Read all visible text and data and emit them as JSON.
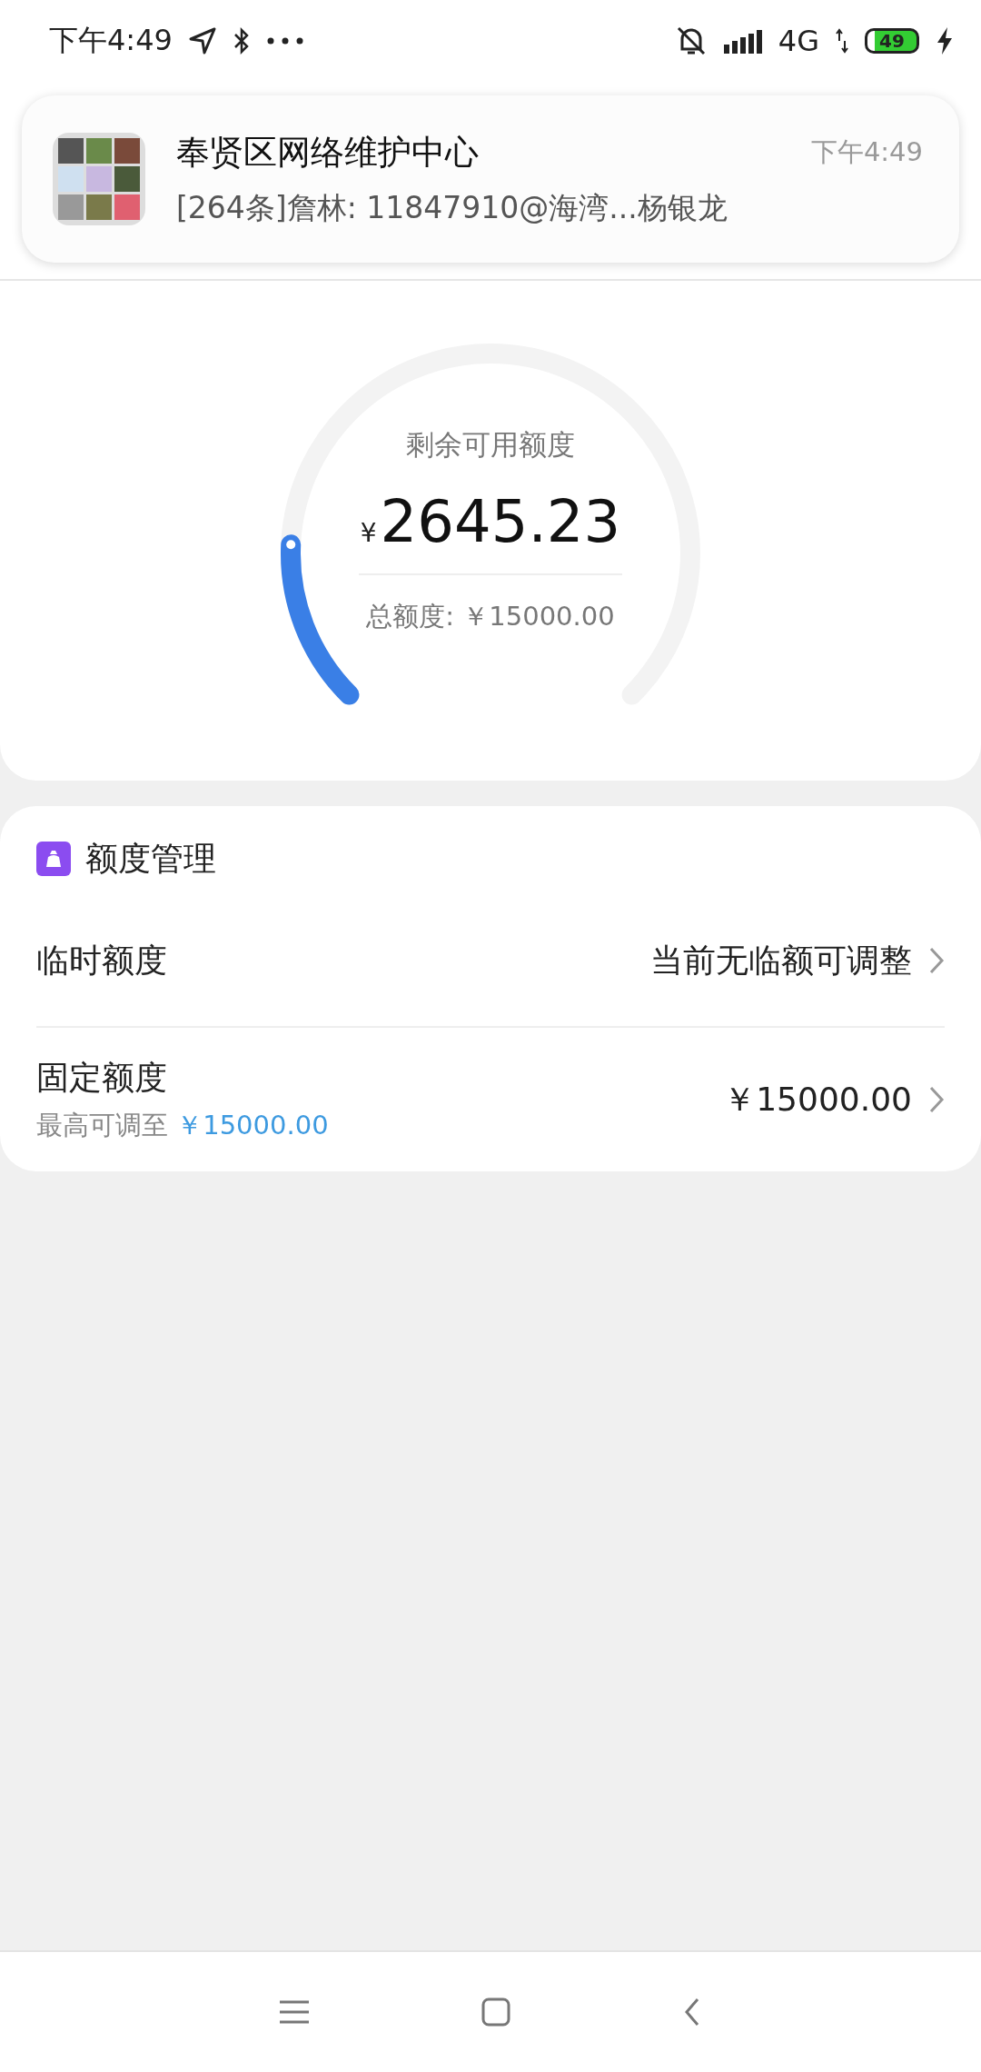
{
  "status_bar": {
    "time": "下午4:49",
    "network": "4G",
    "battery": "49"
  },
  "notification": {
    "title": "奉贤区网络维护中心",
    "time": "下午4:49",
    "message": "[264条]詹林: 11847910@海湾...杨银龙"
  },
  "gauge": {
    "label": "剩余可用额度",
    "currency": "¥",
    "amount": "2645.23",
    "total": "总额度: ￥15000.00"
  },
  "management": {
    "title": "额度管理",
    "rows": [
      {
        "kind": "simple",
        "label": "临时额度",
        "value": "当前无临额可调整"
      },
      {
        "kind": "detail",
        "label": "固定额度",
        "note": "最高可调至",
        "note_amount": "￥15000.00",
        "value": "￥15000.00"
      }
    ]
  }
}
